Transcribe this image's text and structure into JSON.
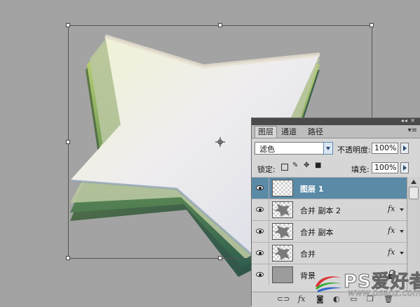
{
  "panel": {
    "collapse_glyph": "◂◂ ✕",
    "tabs": [
      {
        "label": "图层",
        "active": true
      },
      {
        "label": "通道",
        "active": false
      },
      {
        "label": "路径",
        "active": false
      }
    ],
    "menu_glyph": "▾≡",
    "blend_mode": "滤色",
    "opacity_label": "不透明度:",
    "opacity_value": "100%",
    "lock_label": "锁定:",
    "fill_label": "填充:",
    "fill_value": "100%",
    "layers": [
      {
        "name": "图层 1",
        "selected": true,
        "fx": false,
        "locked": false,
        "thumb": "transparent"
      },
      {
        "name": "合并 副本 2",
        "selected": false,
        "fx": true,
        "locked": false,
        "thumb": "star"
      },
      {
        "name": "合并 副本",
        "selected": false,
        "fx": true,
        "locked": false,
        "thumb": "star"
      },
      {
        "name": "合并",
        "selected": false,
        "fx": true,
        "locked": false,
        "thumb": "star"
      },
      {
        "name": "背景",
        "selected": false,
        "fx": false,
        "locked": true,
        "thumb": "gray"
      }
    ],
    "fx_symbol": "fx"
  },
  "watermark": {
    "text": "PS爱好者",
    "sub": "www.psahz.com"
  },
  "colors": {
    "canvas_bg": "#a3a3a3",
    "panel_bg": "#d6d6d6",
    "selected_row": "#5a8aa6"
  }
}
